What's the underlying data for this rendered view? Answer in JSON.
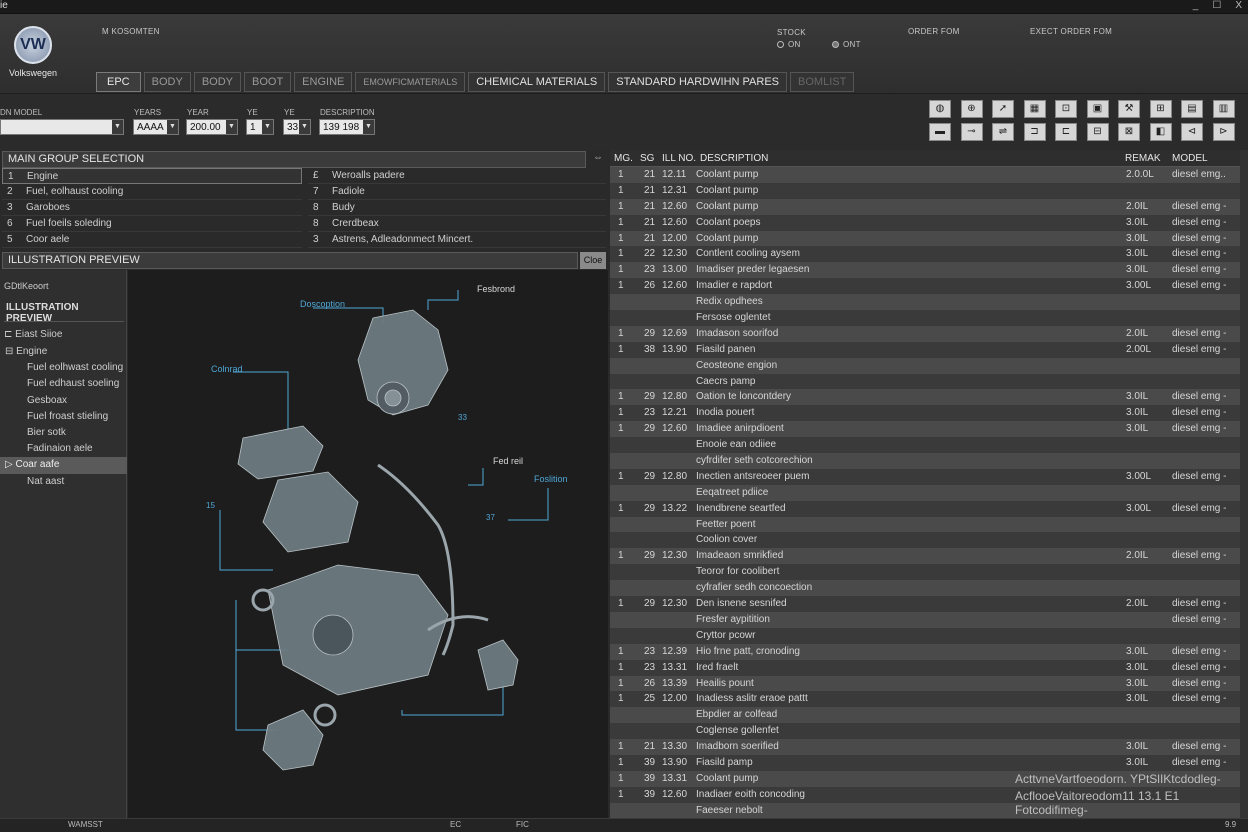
{
  "titlebar": {
    "left_text": "ie",
    "buttons": [
      "_",
      "☐",
      "X"
    ]
  },
  "brand": {
    "logo_text": "VW",
    "name": "Volkswegen",
    "model_label": "M KOSOMTEN"
  },
  "stock": {
    "label": "STOCK",
    "on": "ON",
    "off": "ONT"
  },
  "header_right": {
    "order_form": "ORDER FOM",
    "export_order_form": "EXECT ORDER FOM"
  },
  "tabs": [
    "EPC",
    "BODY",
    "BODY",
    "BOOT",
    "ENGINE",
    "EMOWFICMATERIALS",
    "CHEMICAL MATERIALS",
    "STANDARD HARDWIHN PARES",
    "BOMLIST"
  ],
  "filters": {
    "model_label": "DN MODEL",
    "year1_label": "YEARS",
    "year1_value": "AAAA",
    "year2_label": "YEAR",
    "year2_value": "200.00",
    "f3_label": "YE",
    "f3_value": "1",
    "f4_label": "YE",
    "f4_value": "33",
    "desc_label": "DESCRIPTION",
    "desc_value": "139 198"
  },
  "toolbar_icons": [
    "globe-icon",
    "chip-icon",
    "wrench-icon",
    "grid-icon",
    "camera-icon",
    "edit-icon",
    "tools-icon",
    "pin-icon",
    "doc-icon",
    "more-icon",
    "table-icon",
    "key-icon",
    "link-icon",
    "plug-icon",
    "bracket-icon",
    "expand-icon",
    "cart-icon",
    "clipboard-icon",
    "first-icon",
    "next-icon"
  ],
  "toolbar_glyphs": [
    "◍",
    "⊕",
    "➚",
    "▦",
    "⊡",
    "▣",
    "⚒",
    "⊞",
    "▤",
    "▥",
    "▬",
    "⊸",
    "⇌",
    "⊐",
    "⊏",
    "⊟",
    "⊠",
    "◧",
    "⊲",
    "⊳"
  ],
  "main_group": {
    "title": "MAIN GROUP SELECTION",
    "left": [
      {
        "num": "1",
        "label": "Engine"
      },
      {
        "num": "2",
        "label": "Fuel, eolhaust cooling"
      },
      {
        "num": "3",
        "label": "Garoboes"
      },
      {
        "num": "6",
        "label": "Fuel foeils soleding"
      },
      {
        "num": "5",
        "label": "Coor aele"
      }
    ],
    "right": [
      {
        "num": "£",
        "label": "Weroalls padere"
      },
      {
        "num": "7",
        "label": "Fadiole"
      },
      {
        "num": "8",
        "label": "Budy"
      },
      {
        "num": "8",
        "label": "Crerdbeax"
      },
      {
        "num": "3",
        "label": "Astrens, Adleadonmect Mincert."
      }
    ]
  },
  "illustration": {
    "panel_title": "ILLUSTRATION PREVIEW",
    "close_btn": "Cloe",
    "nav_heading": "GDtlKeoort",
    "nav_title": "ILLUSTRATION PREVIEW",
    "nav_root": "Eiast Siioe",
    "nav_items": [
      "Engine",
      "Fuel eolhwast cooling",
      "Fuel edhaust soeling",
      "Gesboax",
      "Fuel froast stieling",
      "Bier sotk",
      "Fadinaion aele",
      "Coar aafe",
      "Nat aast"
    ],
    "nav_selected": 7,
    "callouts": [
      "Fesbrond",
      "Doscoption",
      "Colnrad",
      "Fed reil",
      "Foslition",
      "33",
      "15",
      "37"
    ]
  },
  "parts": {
    "headers": {
      "mg": "MG.",
      "sg": "SG",
      "ill": "ILL NO.",
      "desc": "DESCRIPTION",
      "remark": "REMAK",
      "model": "MODEL"
    },
    "rows": [
      [
        "1",
        "21",
        "12.11",
        "Coolant pump",
        "2.0.0L",
        "diesel emg.."
      ],
      [
        "1",
        "21",
        "12.31",
        "Coolant pump",
        "",
        ""
      ],
      [
        "1",
        "21",
        "12.60",
        "Coolant pump",
        "2.0IL",
        "diesel emg -"
      ],
      [
        "1",
        "21",
        "12.60",
        "Coolant poeps",
        "3.0IL",
        "diesel emg -"
      ],
      [
        "1",
        "21",
        "12.00",
        "Coolant pump",
        "3.0IL",
        "diesel emg -"
      ],
      [
        "1",
        "22",
        "12.30",
        "Contlent cooling aysem",
        "3.0IL",
        "diesel emg -"
      ],
      [
        "1",
        "23",
        "13.00",
        "Imadiser preder legaesen",
        "3.0IL",
        "diesel emg -"
      ],
      [
        "1",
        "26",
        "12.60",
        "Imadier e rapdort",
        "3.00L",
        "diesel emg -"
      ],
      [
        "",
        "",
        "",
        "Redix opdhees",
        "",
        ""
      ],
      [
        "",
        "",
        "",
        "Fersose oglentet",
        "",
        ""
      ],
      [
        "1",
        "29",
        "12.69",
        "Imadason soorifod",
        "2.0IL",
        "diesel emg -"
      ],
      [
        "1",
        "38",
        "13.90",
        "Fiasild panen",
        "2.00L",
        "diesel emg -"
      ],
      [
        "",
        "",
        "",
        "Ceosteone engion",
        "",
        ""
      ],
      [
        "",
        "",
        "",
        "Caecrs pamp",
        "",
        ""
      ],
      [
        "1",
        "29",
        "12.80",
        "Oation te loncontdery",
        "3.0IL",
        "diesel emg -"
      ],
      [
        "1",
        "23",
        "12.21",
        "Inodia pouert",
        "3.0IL",
        "diesel emg -"
      ],
      [
        "1",
        "29",
        "12.60",
        "Imadiee anirpdioent",
        "3.0IL",
        "diesel emg -"
      ],
      [
        "",
        "",
        "",
        "Enooie ean odiiee",
        "",
        ""
      ],
      [
        "",
        "",
        "",
        "cyfrdifer seth cotcorechion",
        "",
        ""
      ],
      [
        "1",
        "29",
        "12.80",
        "Inectien antsreoeer puem",
        "3.00L",
        "diesel emg -"
      ],
      [
        "",
        "",
        "",
        "Eeqatreet pdiice",
        "",
        ""
      ],
      [
        "1",
        "29",
        "13.22",
        "Inendbrene seartfed",
        "3.00L",
        "diesel emg -"
      ],
      [
        "",
        "",
        "",
        "Feetter poent",
        "",
        ""
      ],
      [
        "",
        "",
        "",
        "Coolion cover",
        "",
        ""
      ],
      [
        "1",
        "29",
        "12.30",
        "Imadeaon smrikfied",
        "2.0IL",
        "diesel emg -"
      ],
      [
        "",
        "",
        "",
        "Teoror for coolibert",
        "",
        ""
      ],
      [
        "",
        "",
        "",
        "cyfrafier sedh concoection",
        "",
        ""
      ],
      [
        "1",
        "29",
        "12.30",
        "Den isnene sesnifed",
        "2.0IL",
        "diesel emg -"
      ],
      [
        "",
        "",
        "",
        "Fresfer aypitition",
        "",
        "diesel emg -"
      ],
      [
        "",
        "",
        "",
        "Cryttor pcowr",
        "",
        ""
      ],
      [
        "1",
        "23",
        "12.39",
        "Hio frne patt, cronoding",
        "3.0IL",
        "diesel emg -"
      ],
      [
        "1",
        "23",
        "13.31",
        "Ired fraelt",
        "3.0IL",
        "diesel emg -"
      ],
      [
        "1",
        "26",
        "13.39",
        "Heailis pount",
        "3.0IL",
        "diesel emg -"
      ],
      [
        "1",
        "25",
        "12.00",
        "Inadiess aslitr eraoe pattt",
        "3.0IL",
        "diesel emg -"
      ],
      [
        "",
        "",
        "",
        "Ebpdier ar colfead",
        "",
        ""
      ],
      [
        "",
        "",
        "",
        "Coglense gollenfet",
        "",
        ""
      ],
      [
        "1",
        "21",
        "13.30",
        "Imadborn soerified",
        "3.0IL",
        "diesel emg -"
      ],
      [
        "1",
        "39",
        "13.90",
        "Fiasild pamp",
        "3.0IL",
        "diesel emg -"
      ],
      [
        "1",
        "39",
        "13.31",
        "Coolant pump",
        "",
        ""
      ],
      [
        "1",
        "39",
        "12.60",
        "Inadiaer eoith concoding",
        "",
        ""
      ],
      [
        "",
        "",
        "",
        "Faeeser nebolt",
        "",
        ""
      ]
    ]
  },
  "watermark": {
    "line1": "ActtvneVartfoeodorn. YPtSlIKtcdodleg-",
    "line2": "AcflooeVaitoreodom11 13.1 E1 Fotcodifimeg-"
  },
  "status": {
    "left": "WAMSST",
    "mid1": "EC",
    "mid2": "FIC",
    "right": "9.9"
  }
}
